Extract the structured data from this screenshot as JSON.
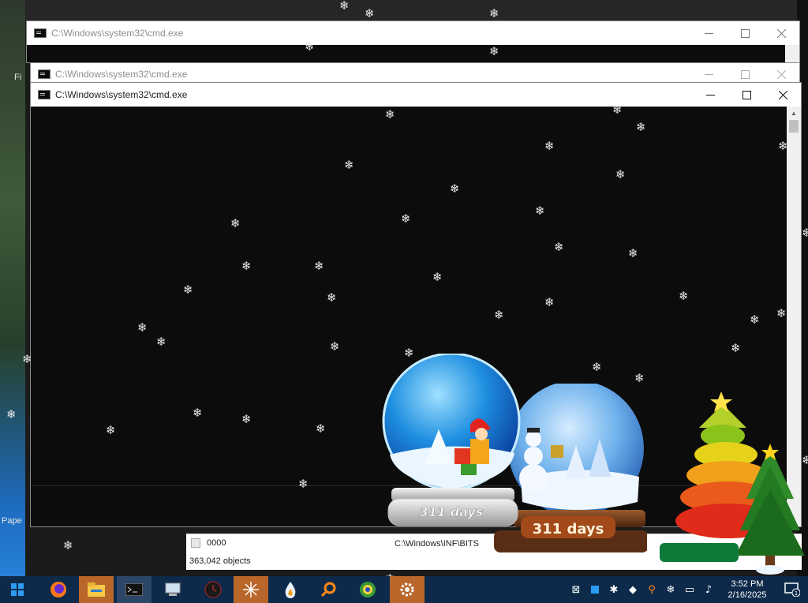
{
  "desktop": {
    "left_labels": [
      "Fi",
      "Pape"
    ]
  },
  "windows": [
    {
      "title": "C:\\Windows\\system32\\cmd.exe",
      "state": "inactive"
    },
    {
      "title": "C:\\Windows\\system32\\cmd.exe",
      "state": "inactive"
    },
    {
      "title": "C:\\Windows\\system32\\cmd.exe",
      "state": "active"
    }
  ],
  "explorer": {
    "file_name": "0000",
    "path": "C:\\Windows\\INF\\BITS",
    "object_count": "363,042 objects"
  },
  "globes": [
    {
      "label": "311 days"
    },
    {
      "label": "311 days"
    }
  ],
  "taskbar": {
    "items": [
      {
        "icon": "windows-start-icon"
      },
      {
        "icon": "firefox-icon"
      },
      {
        "icon": "file-explorer-icon"
      },
      {
        "icon": "command-prompt-icon"
      },
      {
        "icon": "computer-icon"
      },
      {
        "icon": "clock-app-icon"
      },
      {
        "icon": "snowflake-app-icon"
      },
      {
        "icon": "water-drop-icon"
      },
      {
        "icon": "search-magnifier-icon"
      },
      {
        "icon": "globe-app-icon"
      },
      {
        "icon": "gear-app-icon"
      }
    ],
    "clock": {
      "time": "3:52 PM",
      "date": "2/16/2025"
    },
    "notification_count": "1"
  },
  "colors": {
    "taskbar": "#0d2a4a",
    "taskbar_active": "#b9662a",
    "console_bg": "#0c0c0c"
  }
}
